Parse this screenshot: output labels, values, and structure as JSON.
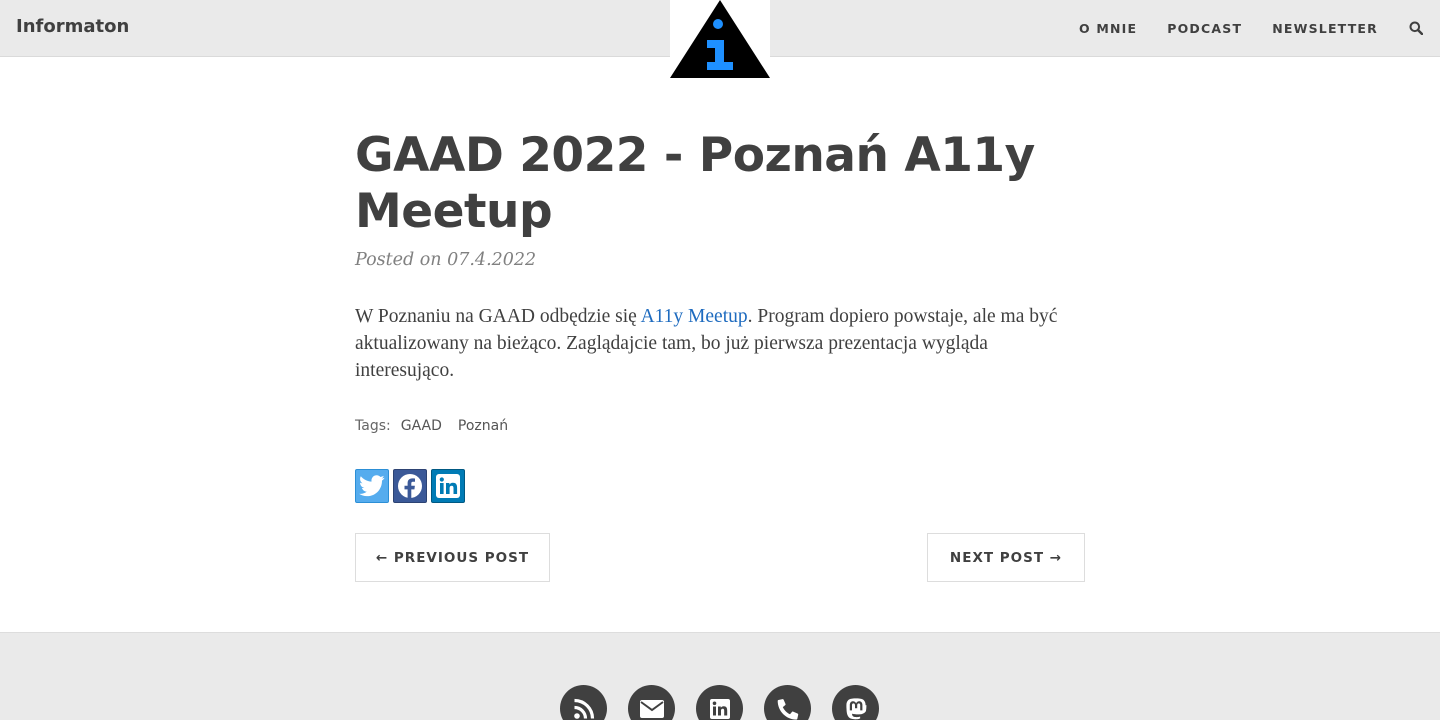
{
  "navbar": {
    "brand": "Informaton",
    "links": [
      {
        "label": "O MNIE"
      },
      {
        "label": "PODCAST"
      },
      {
        "label": "NEWSLETTER"
      }
    ],
    "search_icon": "search-icon"
  },
  "logo": {
    "icon": "info-triangle-logo",
    "colors": {
      "triangle": "#000000",
      "glyph": "#1e90ff"
    }
  },
  "post": {
    "title": "GAAD 2022 - Poznań A11y Meetup",
    "meta": "Posted on 07.4.2022",
    "body_before": "W Poznaniu na GAAD odbędzie się ",
    "body_link": "A11y Meetup",
    "body_after": ". Program dopiero powstaje, ale ma być aktualizowany na bieżąco. Zaglądajcie tam, bo już pierwsza prezentacja wygląda interesująco."
  },
  "tags": {
    "label": "Tags:",
    "items": [
      "GAAD",
      "Poznań"
    ]
  },
  "share": [
    {
      "icon": "twitter-icon",
      "color": "#55acee"
    },
    {
      "icon": "facebook-icon",
      "color": "#3b5998"
    },
    {
      "icon": "linkedin-icon",
      "color": "#007bb5"
    }
  ],
  "pager": {
    "prev": "← PREVIOUS POST",
    "next": "NEXT POST →"
  },
  "footer": {
    "icons": [
      "rss-icon",
      "envelope-icon",
      "linkedin-icon",
      "phone-icon",
      "mastodon-icon"
    ],
    "icon_color": "#404040"
  }
}
